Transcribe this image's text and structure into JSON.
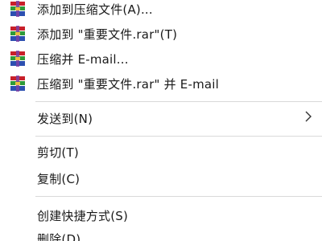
{
  "context_menu": {
    "archive_items": [
      {
        "label": "添加到压缩文件(A)...",
        "icon": "winrar-archive-icon"
      },
      {
        "label": "添加到 \"重要文件.rar\"(T)",
        "icon": "winrar-archive-icon"
      },
      {
        "label": "压缩并 E-mail...",
        "icon": "winrar-archive-icon"
      },
      {
        "label": "压缩到 \"重要文件.rar\" 并 E-mail",
        "icon": "winrar-archive-icon"
      }
    ],
    "send_to": {
      "label": "发送到(N)",
      "icon": "chevron-right-icon"
    },
    "cut": {
      "label": "剪切(T)"
    },
    "copy": {
      "label": "复制(C)"
    },
    "create_shortcut": {
      "label": "创建快捷方式(S)"
    },
    "delete": {
      "label": "删除(D)"
    }
  },
  "colors": {
    "background": "#ffffff",
    "text": "#1a1a1a",
    "separator": "#d9d9d9",
    "winrar_red": "#c8202a",
    "winrar_green": "#2f9a3a",
    "winrar_blue": "#2c4fb0",
    "winrar_purple": "#7a3fa6"
  }
}
